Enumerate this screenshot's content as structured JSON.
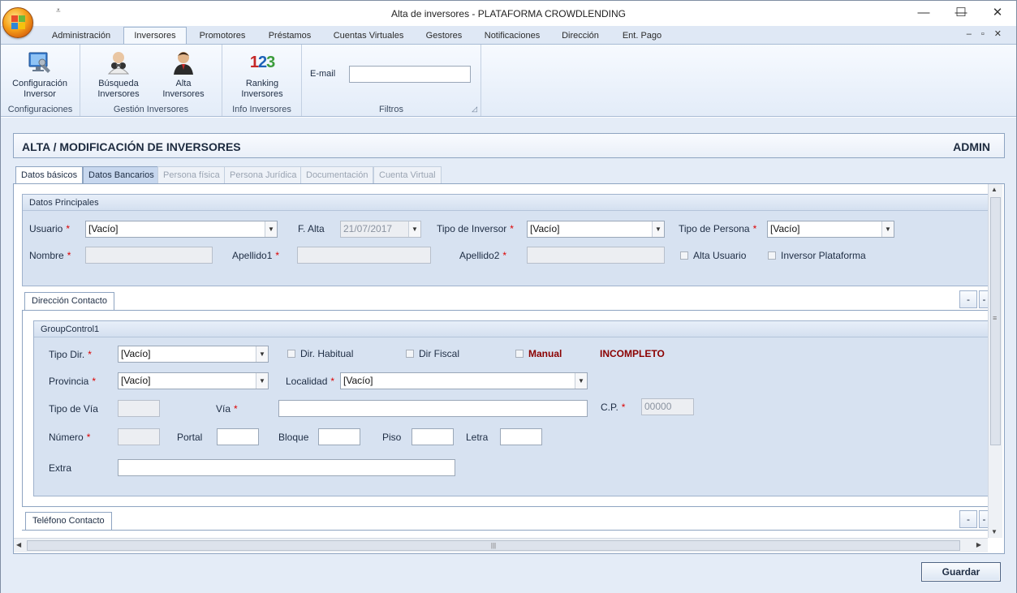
{
  "window": {
    "title": "Alta de inversores - PLATAFORMA CROWDLENDING",
    "minimize": "—",
    "maximize": "☐",
    "close": "✕"
  },
  "qat": {
    "label": "⩡"
  },
  "ribbon_tabs": [
    "Administración",
    "Inversores",
    "Promotores",
    "Préstamos",
    "Cuentas Virtuales",
    "Gestores",
    "Notificaciones",
    "Dirección",
    "Ent. Pago"
  ],
  "mdi_controls": "–▫✕",
  "ribbon": {
    "configuracion_inversor": "Configuración Inversor",
    "configuraciones_group": "Configuraciones",
    "busqueda_inversores": "Búsqueda Inversores",
    "alta_inversores": "Alta Inversores",
    "gestion_group": "Gestión Inversores",
    "ranking_inversores": "Ranking Inversores",
    "ranking_icon_text": "123",
    "info_group": "Info Inversores",
    "email_label": "E-mail",
    "email_value": "",
    "filtros_group": "Filtros",
    "dialog_launcher": "◿"
  },
  "header": {
    "title": "ALTA / MODIFICACIÓN DE INVERSORES",
    "user": "ADMIN"
  },
  "page_tabs": [
    "Datos básicos",
    "Datos Bancarios",
    "Persona física",
    "Persona Jurídica",
    "Documentación",
    "Cuenta Virtual"
  ],
  "datos_principales": {
    "title": "Datos Principales",
    "usuario_label": "Usuario",
    "usuario_value": "[Vacío]",
    "falta_label": "F. Alta",
    "falta_value": "21/07/2017",
    "tipo_inversor_label": "Tipo de Inversor",
    "tipo_inversor_value": "[Vacío]",
    "tipo_persona_label": "Tipo de Persona",
    "tipo_persona_value": "[Vacío]",
    "nombre_label": "Nombre",
    "apellido1_label": "Apellido1",
    "apellido2_label": "Apellido2",
    "alta_usuario_label": "Alta Usuario",
    "inversor_plataforma_label": "Inversor Plataforma",
    "required": "*"
  },
  "direccion": {
    "tab": "Dirección Contacto",
    "group_title": "GroupControl1",
    "tipo_dir_label": "Tipo Dir.",
    "tipo_dir_value": "[Vacío]",
    "dir_habitual_label": "Dir. Habitual",
    "dir_fiscal_label": "Dir Fiscal",
    "manual_label": "Manual",
    "status": "INCOMPLETO",
    "provincia_label": "Provincia",
    "provincia_value": "[Vacío]",
    "localidad_label": "Localidad",
    "localidad_value": "[Vacío]",
    "tipo_via_label": "Tipo de Vía",
    "via_label": "Vía",
    "cp_label": "C.P.",
    "cp_value": "00000",
    "numero_label": "Número",
    "portal_label": "Portal",
    "bloque_label": "Bloque",
    "piso_label": "Piso",
    "letra_label": "Letra",
    "extra_label": "Extra",
    "collapse": "-",
    "expand": "-"
  },
  "telefono": {
    "tab": "Teléfono Contacto",
    "collapse": "-",
    "expand": "-"
  },
  "scroll": {
    "up": "▲",
    "down": "▼",
    "left": "◀",
    "right": "▶",
    "grip": "|||",
    "vgrip": "≡"
  },
  "guardar": "Guardar",
  "colors": {
    "accent": "#8ea4c1",
    "required": "#dd0000",
    "status": "#8b0000"
  }
}
